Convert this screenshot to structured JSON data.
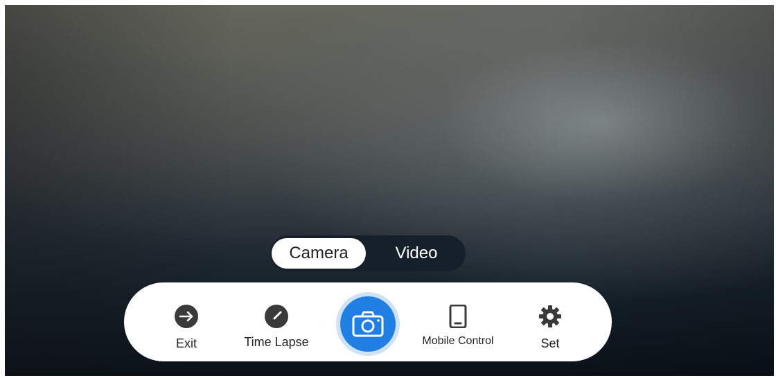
{
  "mode_switch": {
    "camera_label": "Camera",
    "video_label": "Video",
    "selected": "Camera"
  },
  "toolbar": {
    "exit_label": "Exit",
    "time_lapse_label": "Time Lapse",
    "mobile_control_label": "Mobile Control",
    "set_label": "Set"
  },
  "icons": {
    "exit": "arrow-right-circle-icon",
    "time_lapse": "timer-icon",
    "shutter": "camera-icon",
    "mobile_control": "tablet-icon",
    "set": "gear-icon"
  },
  "colors": {
    "shutter_blue": "#1f7fe2",
    "shutter_ring": "#cfe2f8",
    "toolbar_bg": "#ffffff",
    "mode_switch_bg": "#15202a",
    "icon_dark": "#3a3a3a"
  }
}
